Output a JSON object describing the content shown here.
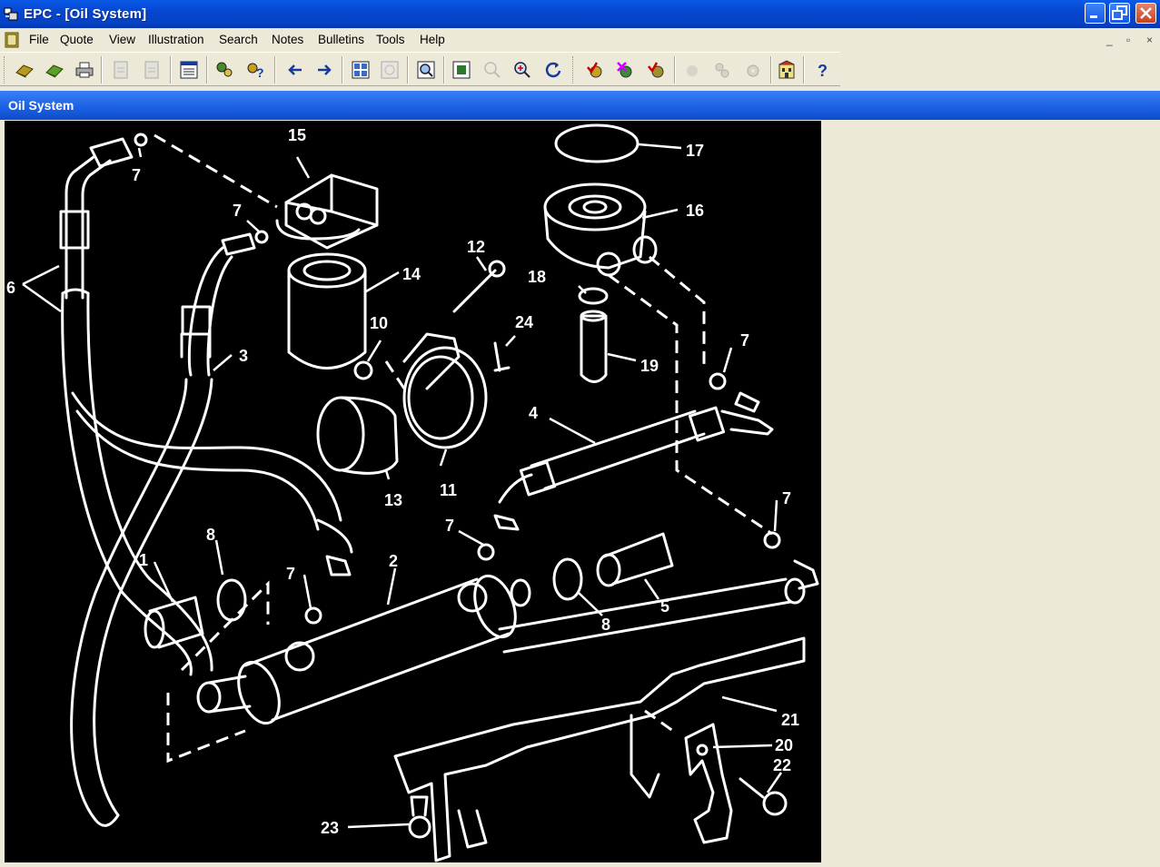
{
  "window": {
    "title": "EPC - [Oil System]",
    "controls": [
      "minimize",
      "maximize",
      "close"
    ]
  },
  "menubar": {
    "items": [
      "File",
      "Quote",
      "View",
      "Illustration",
      "Search",
      "Notes",
      "Bulletins",
      "Tools",
      "Help"
    ],
    "mdi_controls": [
      "_",
      "▫",
      "×"
    ]
  },
  "toolbar": {
    "buttons": [
      {
        "icon": "book-open-icon",
        "enabled": true
      },
      {
        "icon": "book-green-icon",
        "enabled": true
      },
      {
        "icon": "printer-icon",
        "enabled": true
      },
      {
        "icon": "page-prev-icon",
        "enabled": false
      },
      {
        "icon": "page-next-icon",
        "enabled": false
      },
      {
        "icon": "list-window-icon",
        "enabled": true
      },
      {
        "icon": "find-part-icon",
        "enabled": true
      },
      {
        "icon": "find-help-icon",
        "enabled": true
      },
      {
        "icon": "arrow-left-icon",
        "enabled": true
      },
      {
        "icon": "arrow-right-icon",
        "enabled": true
      },
      {
        "icon": "grid-view-icon",
        "enabled": true
      },
      {
        "icon": "image-view-icon",
        "enabled": false
      },
      {
        "icon": "zoom-fit-icon",
        "enabled": true
      },
      {
        "icon": "zoom-window-icon",
        "enabled": true
      },
      {
        "icon": "zoom-out-icon",
        "enabled": false
      },
      {
        "icon": "zoom-in-icon",
        "enabled": true
      },
      {
        "icon": "refresh-icon",
        "enabled": true
      },
      {
        "icon": "check-gear-icon",
        "enabled": true
      },
      {
        "icon": "cross-gear-icon",
        "enabled": true
      },
      {
        "icon": "gear-add-icon",
        "enabled": true
      },
      {
        "icon": "gear-gray-1-icon",
        "enabled": false
      },
      {
        "icon": "gear-gray-2-icon",
        "enabled": false
      },
      {
        "icon": "gear-gray-3-icon",
        "enabled": false
      },
      {
        "icon": "building-icon",
        "enabled": true
      },
      {
        "icon": "help-icon",
        "enabled": true
      }
    ]
  },
  "panel": {
    "title": "Oil System"
  },
  "illustration": {
    "callouts": [
      "1",
      "2",
      "3",
      "4",
      "5",
      "6",
      "7",
      "7",
      "7",
      "7",
      "7",
      "7",
      "8",
      "8",
      "10",
      "11",
      "12",
      "13",
      "14",
      "15",
      "16",
      "17",
      "18",
      "19",
      "20",
      "21",
      "22",
      "23",
      "24"
    ]
  },
  "colors": {
    "titlebar": "#0646d0",
    "chrome": "#ece9d8",
    "drawing_bg": "#000000",
    "drawing_line": "#ffffff"
  }
}
